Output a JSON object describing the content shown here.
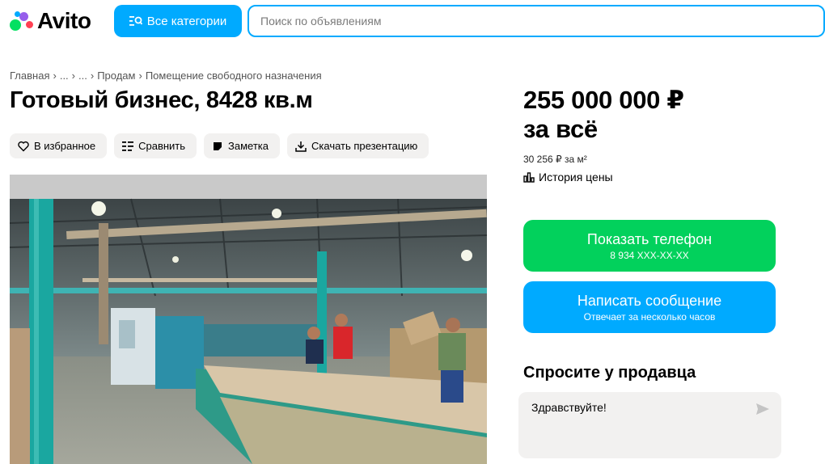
{
  "header": {
    "logo_text": "Avito",
    "categories_label": "Все категории",
    "search_placeholder": "Поиск по объявлениям"
  },
  "breadcrumb": [
    "Главная",
    "...",
    "...",
    "Продам",
    "Помещение свободного назначения"
  ],
  "breadcrumb_sep": "›",
  "listing": {
    "title": "Готовый бизнес, 8428 кв.м"
  },
  "actions": {
    "favorite": "В избранное",
    "compare": "Сравнить",
    "note": "Заметка",
    "download": "Скачать презентацию"
  },
  "price": {
    "amount": "255 000 000 ₽",
    "suffix": "за всё",
    "per_m2": "30 256 ₽ за м²",
    "history_label": "История цены"
  },
  "contact": {
    "phone_label": "Показать телефон",
    "phone_masked": "8 934 XXX-XX-XX",
    "message_label": "Написать сообщение",
    "message_sub": "Отвечает за несколько часов"
  },
  "ask": {
    "title": "Спросите у продавца",
    "message": "Здравствуйте!"
  },
  "colors": {
    "accent_blue": "#00aaff",
    "accent_green": "#02d15c"
  }
}
